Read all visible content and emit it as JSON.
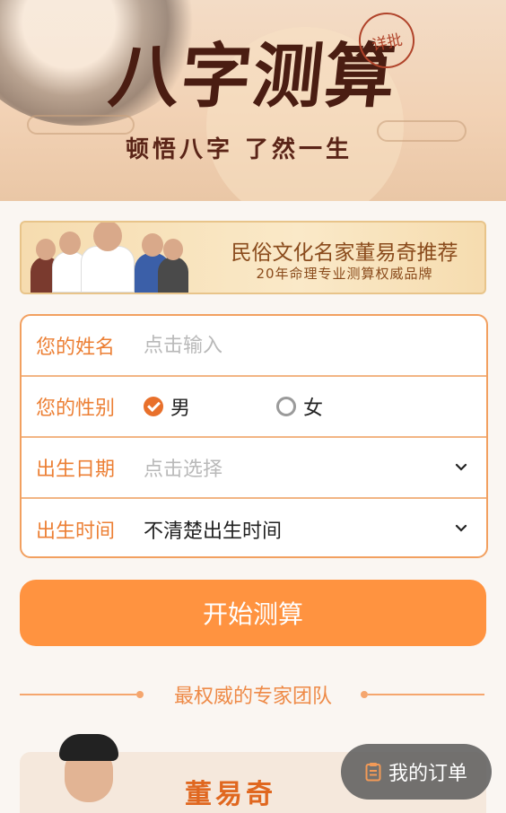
{
  "hero": {
    "title": "八字测算",
    "stamp": "详批",
    "subtitle": "顿悟八字 了然一生"
  },
  "banner": {
    "line1": "民俗文化名家董易奇推荐",
    "line2": "20年命理专业测算权威品牌"
  },
  "form": {
    "name": {
      "label": "您的姓名",
      "placeholder": "点击输入",
      "value": ""
    },
    "gender": {
      "label": "您的性别",
      "options": [
        {
          "label": "男",
          "selected": true
        },
        {
          "label": "女",
          "selected": false
        }
      ]
    },
    "birth_date": {
      "label": "出生日期",
      "placeholder": "点击选择",
      "icon": "chevron-down-icon"
    },
    "birth_time": {
      "label": "出生时间",
      "value": "不清楚出生时间",
      "icon": "chevron-down-icon"
    }
  },
  "actions": {
    "start_label": "开始测算"
  },
  "experts": {
    "section_title": "最权威的专家团队",
    "items": [
      {
        "name": "董易奇"
      }
    ]
  },
  "floating": {
    "orders_label": "我的订单",
    "icon": "clipboard-icon"
  },
  "colors": {
    "accent": "#ff9340",
    "label": "#ec7f34",
    "border": "#f2a060",
    "background": "#faf6f2"
  }
}
